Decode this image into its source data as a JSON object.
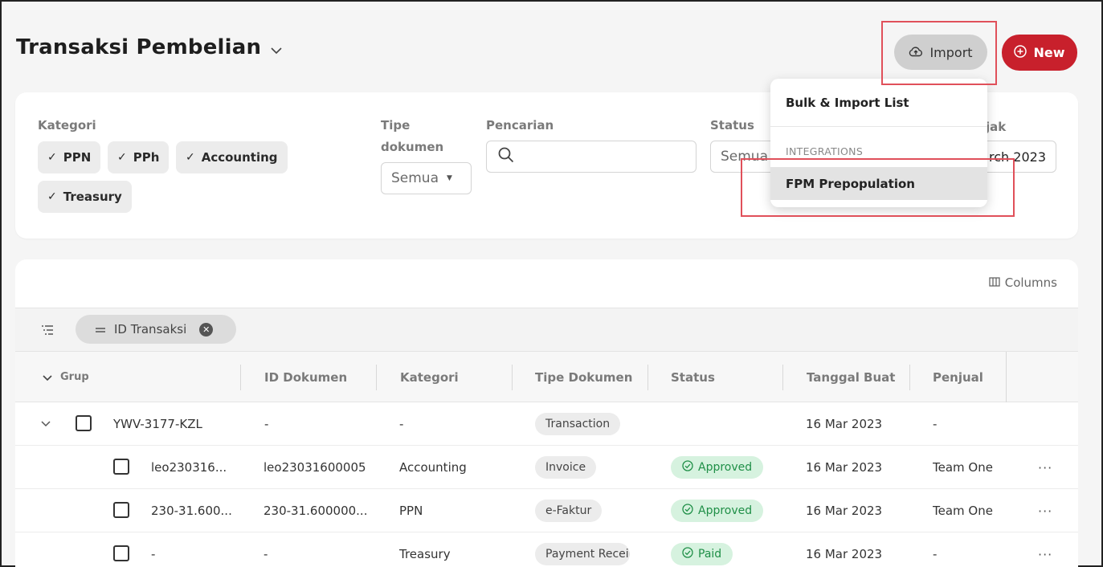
{
  "page": {
    "title": "Transaksi Pembelian"
  },
  "header": {
    "import_label": "Import",
    "new_label": "New"
  },
  "dropdown": {
    "bulk_label": "Bulk & Import List",
    "section_heading": "INTEGRATIONS",
    "fpm_label": "FPM Prepopulation"
  },
  "filters": {
    "kategori_label": "Kategori",
    "kategori_chips": [
      "PPN",
      "PPh",
      "Accounting",
      "Treasury"
    ],
    "tipe_label_line1": "Tipe",
    "tipe_label_line2": "dokumen",
    "tipe_value": "Semua",
    "pencarian_label": "Pencarian",
    "search_placeholder": "",
    "status_label": "Status",
    "status_value": "Semua",
    "masa_label_partial": "jak",
    "masa_value_partial": "rch 2023"
  },
  "table": {
    "columns_label": "Columns",
    "group_chip_label": "ID Transaksi",
    "headers": {
      "grup": "Grup",
      "id_dokumen": "ID Dokumen",
      "kategori": "Kategori",
      "tipe_dokumen": "Tipe Dokumen",
      "status": "Status",
      "tanggal_buat": "Tanggal Buat",
      "penjual": "Penjual"
    },
    "rows": [
      {
        "group": "YWV-3177-KZL",
        "id_dokumen": "-",
        "kategori": "-",
        "tipe": "Transaction",
        "status": "",
        "tanggal": "16 Mar 2023",
        "penjual": "-"
      },
      {
        "group": "leo230316...",
        "id_dokumen": "leo23031600005",
        "kategori": "Accounting",
        "tipe": "Invoice",
        "status": "Approved",
        "tanggal": "16 Mar 2023",
        "penjual": "Team One"
      },
      {
        "group": "230-31.600...",
        "id_dokumen": "230-31.600000...",
        "kategori": "PPN",
        "tipe": "e-Faktur",
        "status": "Approved",
        "tanggal": "16 Mar 2023",
        "penjual": "Team One"
      },
      {
        "group": "-",
        "id_dokumen": "-",
        "kategori": "Treasury",
        "tipe": "Payment Receip",
        "status": "Paid",
        "tanggal": "16 Mar 2023",
        "penjual": "-"
      }
    ],
    "row_menu_glyph": "···"
  },
  "colors": {
    "accent_red": "#c8202c",
    "highlight_box": "#e0505a",
    "status_green": "#1f8f47",
    "status_bg": "#d6f2df"
  }
}
